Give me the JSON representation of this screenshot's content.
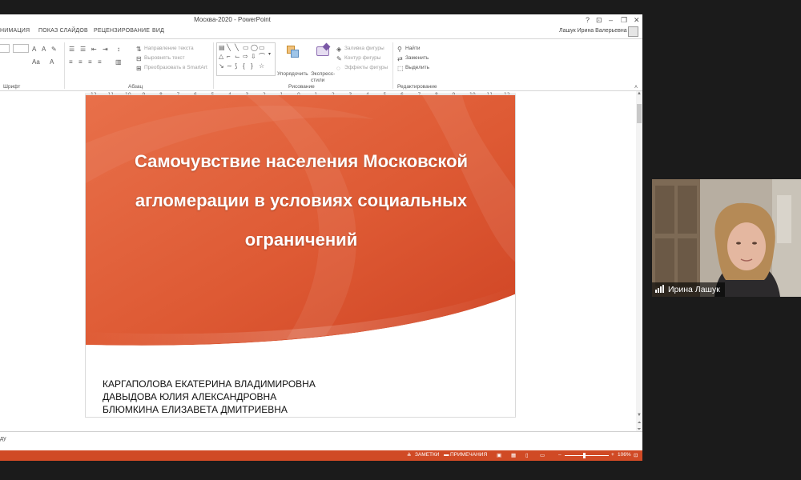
{
  "window": {
    "title": "Москва-2020 - PowerPoint",
    "controls": [
      "?",
      "⊡",
      "–",
      "❐",
      "✕"
    ]
  },
  "ribbon": {
    "tabs": [
      "НИМАЦИЯ",
      "ПОКАЗ СЛАЙДОВ",
      "РЕЦЕНЗИРОВАНИЕ",
      "ВИД"
    ],
    "user": "Лашук Ирина Валерьевна",
    "paragraph_commands": [
      "Направление текста",
      "Выровнять текст",
      "Преобразовать в SmartArt"
    ],
    "drawing_commands": {
      "arrange": "Упорядочить",
      "quick_styles": "Экспресс-стили",
      "fill": "Заливка фигуры",
      "outline": "Контур фигуры",
      "effects": "Эффекты фигуры"
    },
    "editing_commands": [
      "Найти",
      "Заменить",
      "Выделить"
    ],
    "group_labels": [
      "Шрифт",
      "Абзац",
      "Рисование",
      "Редактирование"
    ]
  },
  "ruler": [
    "12",
    "11",
    "10",
    "9",
    "8",
    "7",
    "6",
    "5",
    "4",
    "3",
    "2",
    "1",
    "0",
    "1",
    "2",
    "3",
    "4",
    "5",
    "6",
    "7",
    "8",
    "9",
    "10",
    "11",
    "12"
  ],
  "slide": {
    "title_lines": [
      "Самочувствие населения Московской",
      "агломерации в условиях социальных",
      "ограничений"
    ],
    "authors": [
      "КАРГАПОЛОВА ЕКАТЕРИНА ВЛАДИМИРОВНА",
      "ДАВЫДОВА ЮЛИЯ АЛЕКСАНДРОВНА",
      "БЛЮМКИНА ЕЛИЗАВЕТА ДМИТРИЕВНА"
    ]
  },
  "notes": {
    "text": "ду"
  },
  "status": {
    "notes_btn": "ЗАМЕТКИ",
    "comments_btn": "ПРИМЕЧАНИЯ",
    "zoom_minus": "–",
    "zoom_plus": "+",
    "zoom": "106%"
  },
  "participant": {
    "name": "Ирина Лашук"
  },
  "colors": {
    "accent": "#d04a25",
    "slide_orange": "#e0603a",
    "background": "#1b1b1b"
  }
}
